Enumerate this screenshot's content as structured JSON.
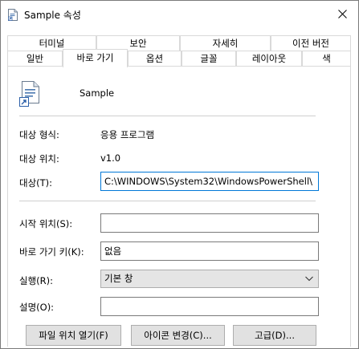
{
  "window": {
    "title": "Sample 속성",
    "title_icon": "shortcut-file-icon",
    "close_icon": "close-icon"
  },
  "tabs": {
    "top_row": [
      "터미널",
      "보안",
      "자세히",
      "이전 버전"
    ],
    "bottom_row": [
      "일반",
      "바로 가기",
      "옵션",
      "글꼴",
      "레이아웃",
      "색"
    ],
    "active": "바로 가기"
  },
  "shortcut": {
    "name": "Sample",
    "icon": "powershell-document-icon",
    "target_type_label": "대상 형식:",
    "target_type_value": "응용 프로그램",
    "target_location_label": "대상 위치:",
    "target_location_value": "v1.0",
    "target_label": "대상(T):",
    "target_value": "C:\\WINDOWS\\System32\\WindowsPowerShell\\",
    "start_in_label": "시작 위치(S):",
    "start_in_value": "",
    "hotkey_label": "바로 가기 키(K):",
    "hotkey_value": "없음",
    "run_label": "실행(R):",
    "run_value": "기본 창",
    "comment_label": "설명(O):",
    "comment_value": ""
  },
  "buttons": {
    "open_location": "파일 위치 열기(F)",
    "change_icon": "아이콘 변경(C)...",
    "advanced": "고급(D)..."
  }
}
